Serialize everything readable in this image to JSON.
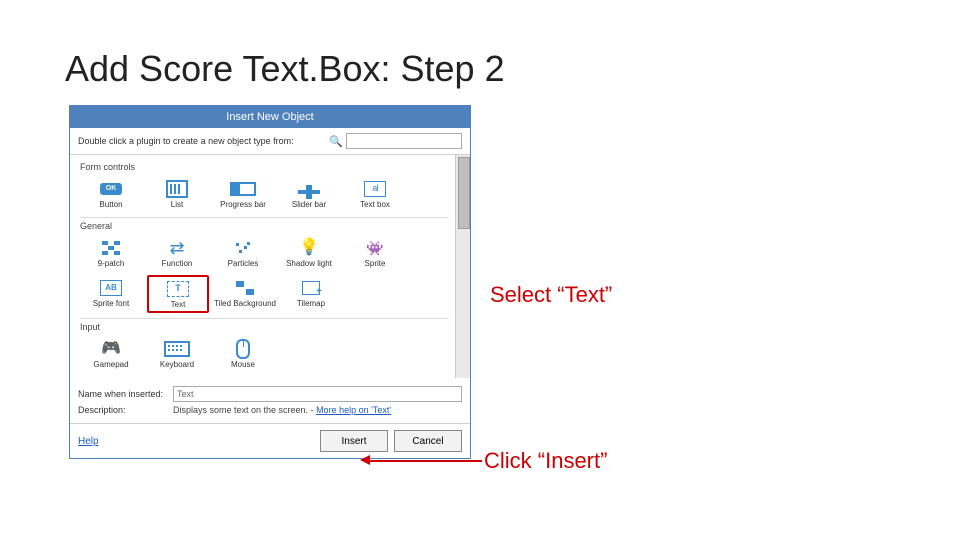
{
  "slide": {
    "title": "Add Score Text.Box: Step 2"
  },
  "dialog": {
    "title": "Insert New Object",
    "instruction": "Double click a plugin to create a new object type from:",
    "search_placeholder": "",
    "categories": {
      "form": "Form controls",
      "general": "General",
      "input": "Input"
    },
    "items": {
      "button": "Button",
      "list": "List",
      "progressbar": "Progress bar",
      "sliderbar": "Slider bar",
      "textbox": "Text box",
      "ninepatch": "9-patch",
      "function": "Function",
      "particles": "Particles",
      "shadowlight": "Shadow light",
      "sprite": "Sprite",
      "spritefont": "Sprite font",
      "text": "Text",
      "tiledbg": "Tiled Background",
      "tilemap": "Tilemap",
      "gamepad": "Gamepad",
      "keyboard": "Keyboard",
      "mouse": "Mouse"
    },
    "name_label": "Name when inserted:",
    "name_value": "Text",
    "desc_label": "Description:",
    "desc_value": "Displays some text on the screen. - ",
    "desc_help": "More help on 'Text'",
    "help": "Help",
    "insert": "Insert",
    "cancel": "Cancel"
  },
  "annotations": {
    "select": "Select “Text”",
    "click": "Click “Insert”"
  }
}
